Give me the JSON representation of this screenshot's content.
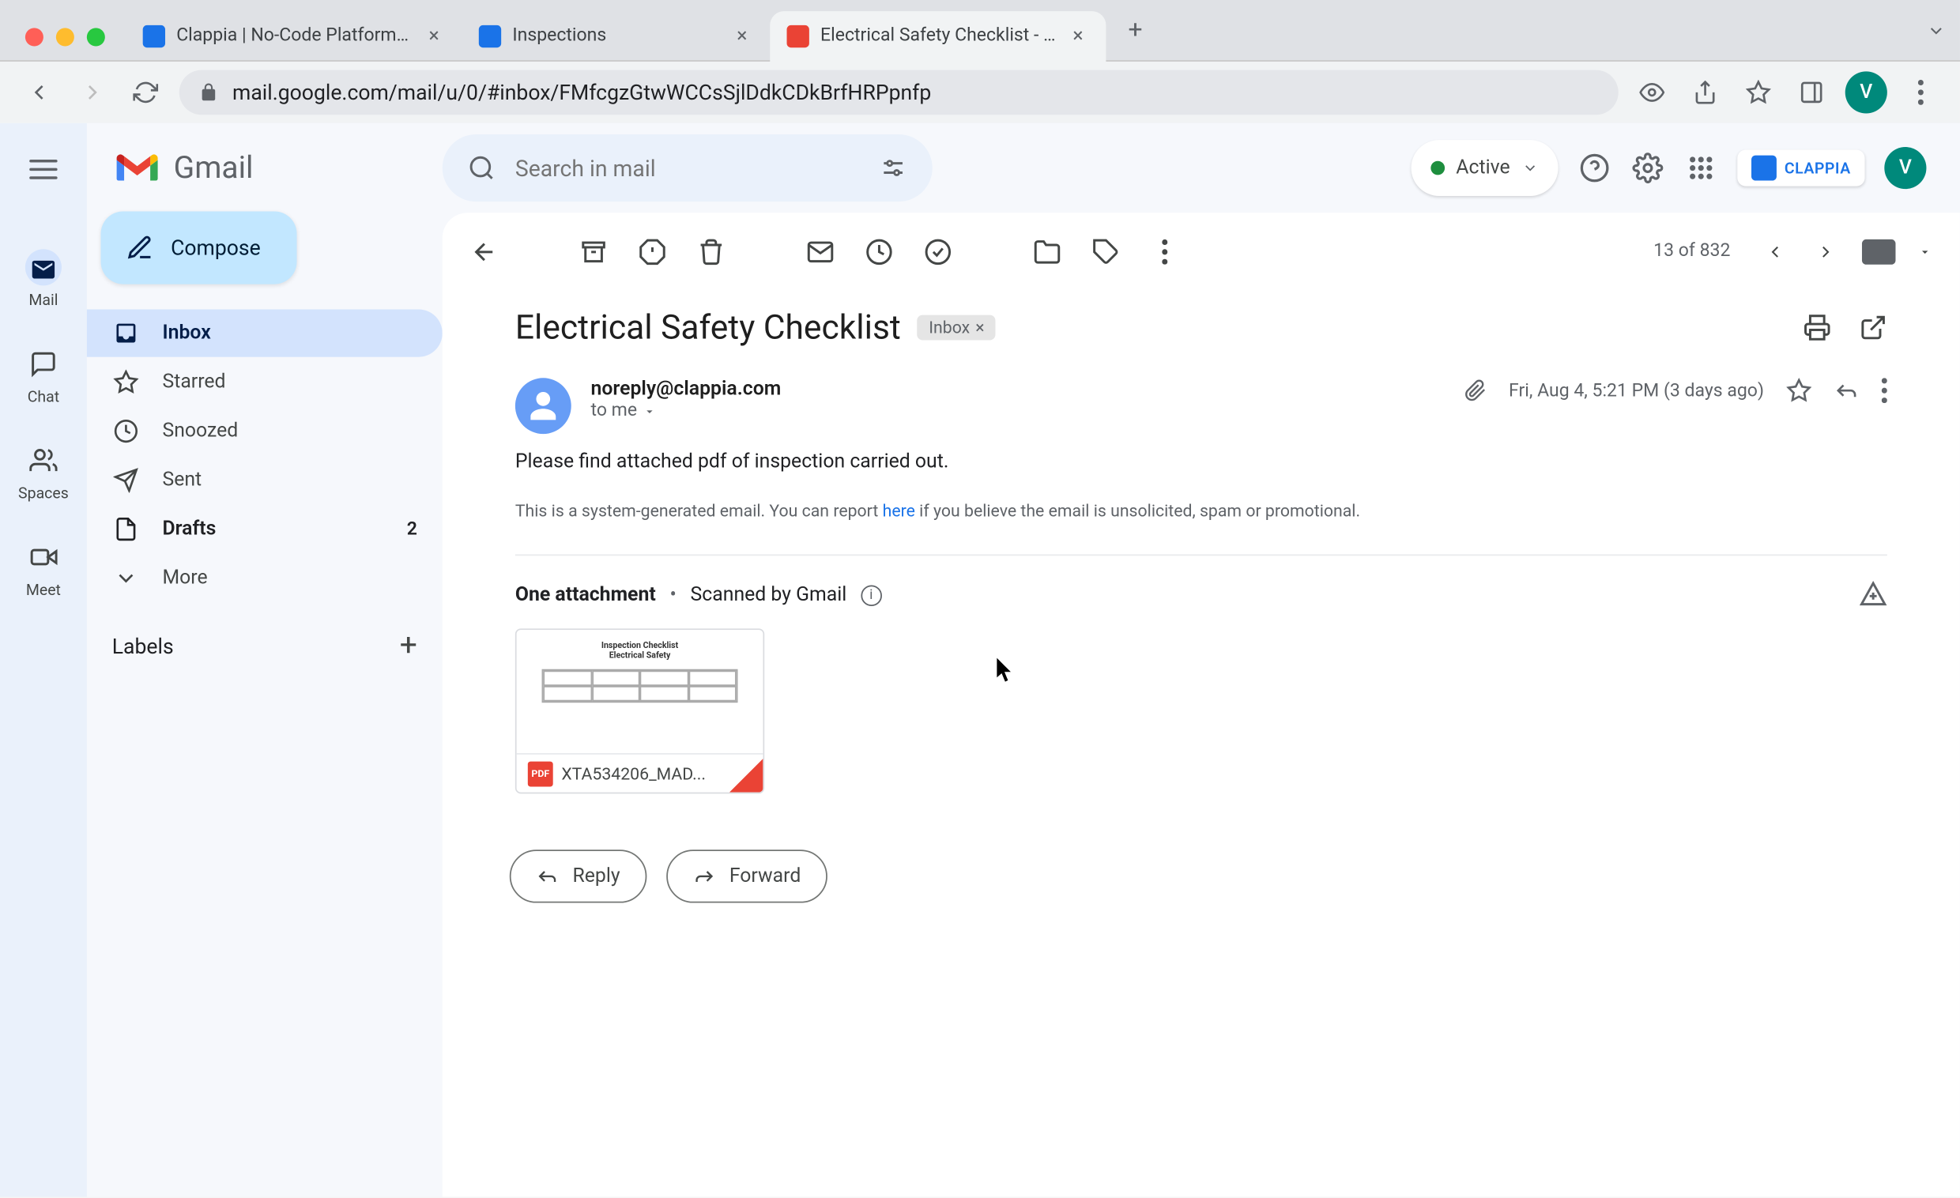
{
  "browser": {
    "tabs": [
      {
        "title": "Clappia | No-Code Platform fo",
        "favicon": "#1a73e8"
      },
      {
        "title": "Inspections",
        "favicon": "#1a73e8"
      },
      {
        "title": "Electrical Safety Checklist - ve",
        "favicon": "#ea4335"
      }
    ],
    "url": "mail.google.com/mail/u/0/#inbox/FMfcgzGtwWCCsSjlDdkCDkBrfHRPpnfp",
    "avatar_letter": "V"
  },
  "left_rail": {
    "items": [
      {
        "label": "Mail"
      },
      {
        "label": "Chat"
      },
      {
        "label": "Spaces"
      },
      {
        "label": "Meet"
      }
    ]
  },
  "gmail_brand": "Gmail",
  "compose_label": "Compose",
  "nav": {
    "items": [
      {
        "label": "Inbox",
        "active": true
      },
      {
        "label": "Starred"
      },
      {
        "label": "Snoozed"
      },
      {
        "label": "Sent"
      },
      {
        "label": "Drafts",
        "count": "2",
        "bold": true
      },
      {
        "label": "More"
      }
    ],
    "labels_heading": "Labels"
  },
  "search": {
    "placeholder": "Search in mail"
  },
  "status": {
    "label": "Active"
  },
  "clappia_chip": "CLAPPIA",
  "toolbar": {
    "count": "13 of 832"
  },
  "message": {
    "subject": "Electrical Safety Checklist",
    "inbox_tag": "Inbox",
    "sender": "noreply@clappia.com",
    "to_line": "to me",
    "date": "Fri, Aug 4, 5:21 PM (3 days ago)",
    "body": "Please find attached pdf of inspection carried out.",
    "disclaimer_prefix": "This is a system-generated email. You can report ",
    "disclaimer_link": "here",
    "disclaimer_suffix": " if you believe the email is unsolicited, spam or promotional.",
    "attach_header_strong": "One attachment",
    "attach_header_rest": "Scanned by Gmail",
    "attachment_name": "XTA534206_MAD...",
    "attachment_preview_title1": "Inspection Checklist",
    "attachment_preview_title2": "Electrical Safety",
    "reply_label": "Reply",
    "forward_label": "Forward"
  }
}
